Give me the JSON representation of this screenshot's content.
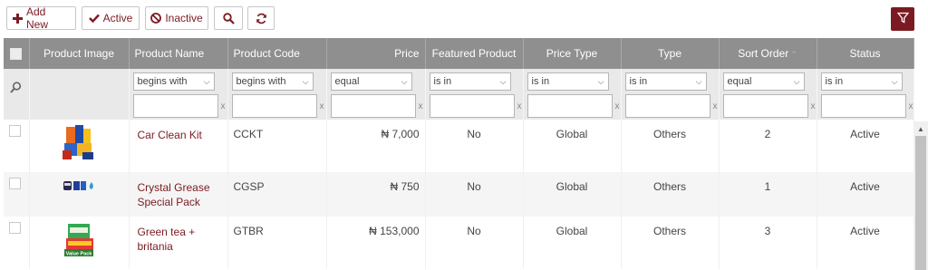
{
  "toolbar": {
    "add_new": "Add New",
    "active": "Active",
    "inactive": "Inactive",
    "icons": {
      "add": "plus-icon",
      "active": "check-icon",
      "inactive": "ban-icon",
      "search": "search-icon",
      "refresh": "refresh-icon",
      "filter": "filter-icon"
    }
  },
  "colors": {
    "accent": "#7b1a22",
    "header_bg": "#8f8f8f",
    "filter_bg": "#e9e9e9",
    "alt_row": "#f5f5f5"
  },
  "columns": [
    "Product Image",
    "Product Name",
    "Product Code",
    "Price",
    "Featured Product",
    "Price Type",
    "Type",
    "Sort Order",
    "Status"
  ],
  "sort_indicator": "⌃",
  "filters": {
    "name_op": "begins with",
    "code_op": "begins with",
    "price_op": "equal",
    "featured_op": "is in",
    "price_type_op": "is in",
    "type_op": "is in",
    "sort_op": "equal",
    "status_op": "is in",
    "clear": "x"
  },
  "rows": [
    {
      "name": "Car Clean Kit",
      "code": "CCKT",
      "price": "₦ 7,000",
      "featured": "No",
      "price_type": "Global",
      "type": "Others",
      "sort": "2",
      "status": "Active"
    },
    {
      "name": "Crystal Grease Special Pack",
      "code": "CGSP",
      "price": "₦ 750",
      "featured": "No",
      "price_type": "Global",
      "type": "Others",
      "sort": "1",
      "status": "Active"
    },
    {
      "name": "Green tea + britania",
      "code": "GTBR",
      "price": "₦ 153,000",
      "featured": "No",
      "price_type": "Global",
      "type": "Others",
      "sort": "3",
      "status": "Active"
    }
  ],
  "image_labels": {
    "value_pack": "Value Pack"
  }
}
